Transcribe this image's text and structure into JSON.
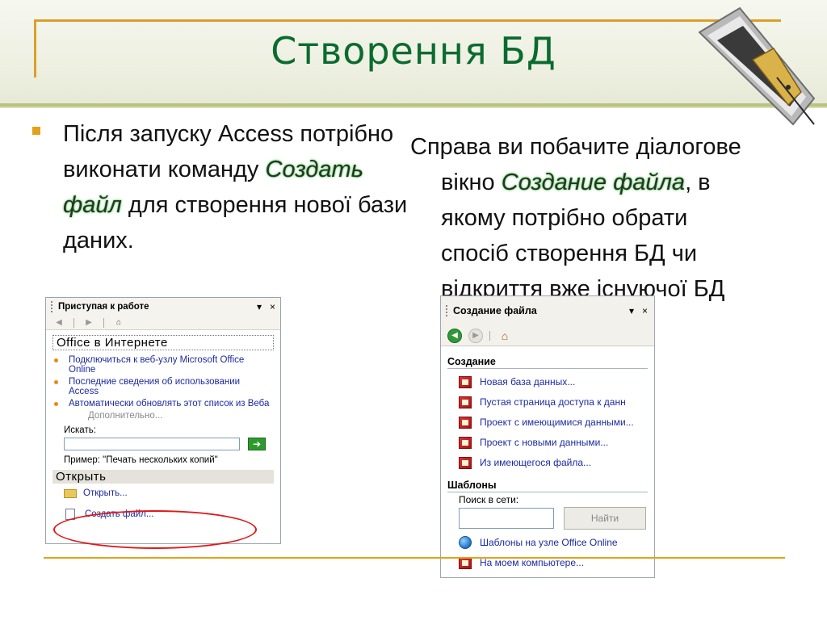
{
  "slide": {
    "title": "Створення БД",
    "left_text": {
      "part1": "Після запуску Access потрібно виконати команду ",
      "emphasis": "Создать файл",
      "part2": " для створення нової бази даних."
    },
    "right_text": {
      "line1": "Справа ви побачите діалогове",
      "line2_a": "вікно ",
      "line2_emphasis": "Создание файла",
      "line2_b": ", в",
      "line3": "якому потрібно обрати",
      "line4": "спосіб створення БД чи",
      "line5": "відкриття вже існуючої БД"
    }
  },
  "panel_start": {
    "title": "Приступая к работе",
    "dropdown_symbol": "▾",
    "close_symbol": "×",
    "nav": {
      "back_symbol": "◀",
      "forward_symbol": "▶",
      "home_symbol": "⌂"
    },
    "office_online": {
      "heading": "Office в Интернете",
      "links": [
        "Подключиться к веб-узлу Microsoft Office Online",
        "Последние сведения об использовании Access",
        "Автоматически обновлять этот список из Веба"
      ],
      "more": "Дополнительно..."
    },
    "search": {
      "label": "Искать:",
      "value": "",
      "go_symbol": "➔",
      "example": "Пример: \"Печать нескольких копий\""
    },
    "open_section": {
      "heading": "Открыть",
      "open_link": "Открыть...",
      "create_link": "Создать файл..."
    }
  },
  "panel_create": {
    "title": "Создание файла",
    "dropdown_symbol": "▾",
    "close_symbol": "×",
    "nav": {
      "back_symbol": "◀",
      "forward_symbol": "▶",
      "home_symbol": "⌂"
    },
    "create_section": {
      "heading": "Создание",
      "items": [
        "Новая база данных...",
        "Пустая страница доступа к данн",
        "Проект с имеющимися данными...",
        "Проект с новыми данными...",
        "Из имеющегося файла..."
      ]
    },
    "templates_section": {
      "heading": "Шаблоны",
      "search_label": "Поиск в сети:",
      "search_value": "",
      "find_button": "Найти",
      "items": [
        "Шаблоны на узле Office Online",
        "На моем компьютере..."
      ]
    }
  },
  "colors": {
    "title_green": "#0b6b2f",
    "accent_gold": "#e3a21a",
    "link_blue": "#1b2aa0",
    "highlight_red": "#e01818"
  }
}
